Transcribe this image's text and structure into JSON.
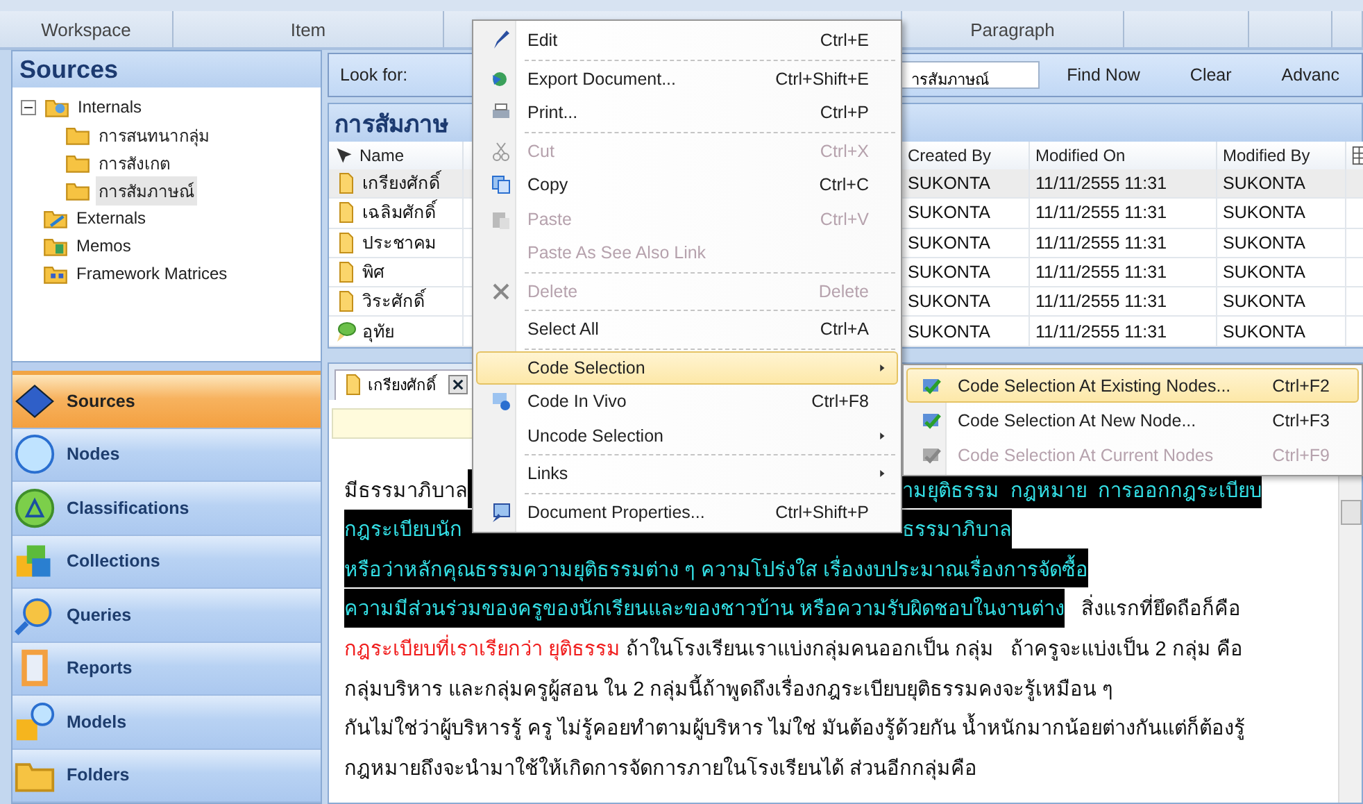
{
  "ribbon": {
    "tabs": [
      {
        "label": "Workspace"
      },
      {
        "label": "Item"
      },
      {
        "label": "Paragraph"
      }
    ]
  },
  "sidebar": {
    "title": "Sources",
    "tree": [
      {
        "label": "Internals",
        "expanded": true,
        "selected": false,
        "children": [
          {
            "label": "การสนทนากลุ่ม",
            "selected": false
          },
          {
            "label": "การสังเกต",
            "selected": false
          },
          {
            "label": "การสัมภาษณ์",
            "selected": true
          }
        ]
      },
      {
        "label": "Externals",
        "selected": false
      },
      {
        "label": "Memos",
        "selected": false
      },
      {
        "label": "Framework Matrices",
        "selected": false
      }
    ],
    "nav": [
      {
        "label": "Sources",
        "selected": true
      },
      {
        "label": "Nodes",
        "selected": false
      },
      {
        "label": "Classifications",
        "selected": false
      },
      {
        "label": "Collections",
        "selected": false
      },
      {
        "label": "Queries",
        "selected": false
      },
      {
        "label": "Reports",
        "selected": false
      },
      {
        "label": "Models",
        "selected": false
      },
      {
        "label": "Folders",
        "selected": false
      }
    ]
  },
  "search": {
    "label": "Look for:",
    "value": "ารสัมภาษณ์",
    "buttons": [
      "Find Now",
      "Clear",
      "Advanc"
    ]
  },
  "list": {
    "title": "การสัมภาษ",
    "name_column": "Name",
    "columns": [
      "Created By",
      "Modified On",
      "Modified By"
    ],
    "rows": [
      {
        "kind": "document",
        "name": "เกรียงศักดิ์",
        "selected": true,
        "cells": [
          "SUKONTA",
          "11/11/2555 11:31",
          "SUKONTA"
        ]
      },
      {
        "kind": "document",
        "name": "เฉลิมศักดิ์",
        "selected": false,
        "cells": [
          "SUKONTA",
          "11/11/2555 11:31",
          "SUKONTA"
        ]
      },
      {
        "kind": "document",
        "name": "ประชาคม",
        "selected": false,
        "cells": [
          "SUKONTA",
          "11/11/2555 11:31",
          "SUKONTA"
        ]
      },
      {
        "kind": "document",
        "name": "พิศ",
        "selected": false,
        "cells": [
          "SUKONTA",
          "11/11/2555 11:31",
          "SUKONTA"
        ]
      },
      {
        "kind": "document",
        "name": "วิระศักดิ์",
        "selected": false,
        "cells": [
          "SUKONTA",
          "11/11/2555 11:31",
          "SUKONTA"
        ]
      },
      {
        "kind": "memo",
        "name": "อุทัย",
        "selected": false,
        "cells": [
          "SUKONTA",
          "11/11/2555 11:31",
          "SUKONTA"
        ]
      }
    ]
  },
  "document": {
    "tab": "เกรียงศักดิ์",
    "lines": [
      {
        "left": [
          {
            "kind": "plain",
            "text": "มีธรรมาภิบาล"
          }
        ],
        "right": [
          {
            "kind": "coded",
            "text": "ามยุติธรรม  กฎหมาย  การออกกฎระเบียบ"
          }
        ]
      },
      {
        "left": [
          {
            "kind": "coded",
            "text": "กฎระเบียบนัก"
          }
        ],
        "right": [
          {
            "kind": "coded",
            "text": "ธรรมาภิบาล"
          }
        ]
      },
      {
        "left": [
          {
            "kind": "coded",
            "text": "หรือว่าหลักคุณธรรมความยุติธรรมต่าง ๆ ความโปร่งใส เรื่องงบประมาณเรื่องการจัดซื้อ"
          }
        ]
      },
      {
        "left": [
          {
            "kind": "coded",
            "text": "ความมีส่วนร่วมของครูของนักเรียนและของชาวบ้าน หรือความรับผิดชอบในงานต่าง"
          },
          {
            "kind": "plain",
            "text": "   สิ่งแรกที่ยึดถือก็คือ"
          }
        ]
      },
      {
        "left": [
          {
            "kind": "red",
            "text": "กฎระเบียบที่เราเรียกว่า ยุติธรรม"
          },
          {
            "kind": "plain",
            "text": " ถ้าในโรงเรียนเราแบ่งกลุ่มคนออกเป็น กลุ่ม   ถ้าครูจะแบ่งเป็น 2 กลุ่ม คือ"
          }
        ]
      },
      {
        "left": [
          {
            "kind": "plain",
            "text": "กลุ่มบริหาร และกลุ่มครูผู้สอน ใน 2 กลุ่มนี้ถ้าพูดถึงเรื่องกฎระเบียบยุติธรรมคงจะรู้เหมือน ๆ"
          }
        ]
      },
      {
        "left": [
          {
            "kind": "plain",
            "text": "กันไม่ใช่ว่าผู้บริหารรู้ ครู ไม่รู้คอยทำตามผู้บริหาร ไม่ใช่ มันต้องรู้ด้วยกัน น้ำหนักมากน้อยต่างกันแต่ก็ต้องรู้"
          }
        ]
      },
      {
        "left": [
          {
            "kind": "plain",
            "text": "กฎหมายถึงจะนำมาใช้ให้เกิดการจัดการภายในโรงเรียนได้ ส่วนอีกกลุ่มคือ"
          }
        ]
      }
    ]
  },
  "context_menu": {
    "items": [
      {
        "kind": "item",
        "label": "Edit",
        "shortcut": "Ctrl+E",
        "disabled": false,
        "selected": false,
        "submenu": false
      },
      {
        "kind": "separator"
      },
      {
        "kind": "item",
        "label": "Export Document...",
        "shortcut": "Ctrl+Shift+E",
        "disabled": false,
        "selected": false,
        "submenu": false
      },
      {
        "kind": "item",
        "label": "Print...",
        "shortcut": "Ctrl+P",
        "disabled": false,
        "selected": false,
        "submenu": false
      },
      {
        "kind": "separator"
      },
      {
        "kind": "item",
        "label": "Cut",
        "shortcut": "Ctrl+X",
        "disabled": true,
        "selected": false,
        "submenu": false
      },
      {
        "kind": "item",
        "label": "Copy",
        "shortcut": "Ctrl+C",
        "disabled": false,
        "selected": false,
        "submenu": false
      },
      {
        "kind": "item",
        "label": "Paste",
        "shortcut": "Ctrl+V",
        "disabled": true,
        "selected": false,
        "submenu": false
      },
      {
        "kind": "item",
        "label": "Paste As See Also Link",
        "disabled": true,
        "selected": false,
        "submenu": false
      },
      {
        "kind": "separator"
      },
      {
        "kind": "item",
        "label": "Delete",
        "shortcut": "Delete",
        "disabled": true,
        "selected": false,
        "submenu": false
      },
      {
        "kind": "separator"
      },
      {
        "kind": "item",
        "label": "Select All",
        "shortcut": "Ctrl+A",
        "disabled": false,
        "selected": false,
        "submenu": false
      },
      {
        "kind": "separator"
      },
      {
        "kind": "item",
        "label": "Code Selection",
        "disabled": false,
        "selected": true,
        "submenu": true
      },
      {
        "kind": "item",
        "label": "Code In Vivo",
        "shortcut": "Ctrl+F8",
        "disabled": false,
        "selected": false,
        "submenu": false
      },
      {
        "kind": "item",
        "label": "Uncode Selection",
        "disabled": false,
        "selected": false,
        "submenu": true
      },
      {
        "kind": "separator"
      },
      {
        "kind": "item",
        "label": "Links",
        "disabled": false,
        "selected": false,
        "submenu": true
      },
      {
        "kind": "separator"
      },
      {
        "kind": "item",
        "label": "Document Properties...",
        "shortcut": "Ctrl+Shift+P",
        "disabled": false,
        "selected": false,
        "submenu": false
      }
    ]
  },
  "submenu": {
    "items": [
      {
        "label": "Code Selection At Existing Nodes...",
        "shortcut": "Ctrl+F2",
        "disabled": false,
        "selected": true
      },
      {
        "label": "Code Selection At New Node...",
        "shortcut": "Ctrl+F3",
        "disabled": false,
        "selected": false
      },
      {
        "label": "Code Selection At Current Nodes",
        "shortcut": "Ctrl+F9",
        "disabled": true,
        "selected": false
      }
    ]
  }
}
